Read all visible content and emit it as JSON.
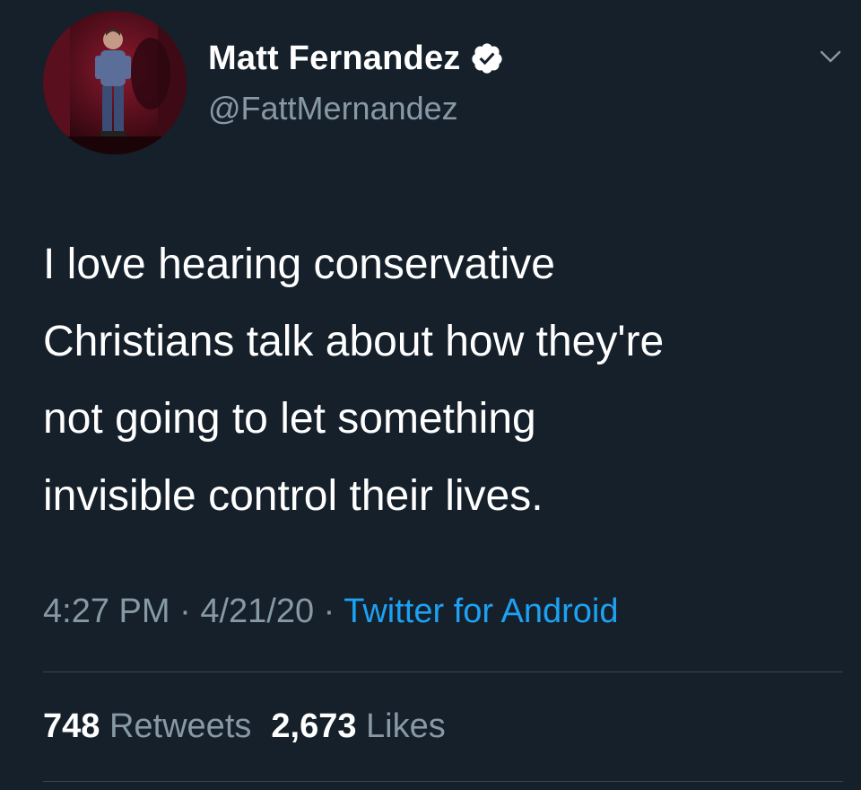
{
  "author": {
    "display_name": "Matt Fernandez",
    "handle": "@FattMernandez",
    "verified": true,
    "avatar_icon": "avatar-comedian-on-stage"
  },
  "tweet": {
    "text": "I love hearing conservative\nChristians talk about how they're\nnot going to let something\ninvisible control their lives.",
    "time": "4:27 PM",
    "separator1": " · ",
    "date": "4/21/20",
    "separator2": " · ",
    "source": "Twitter for Android"
  },
  "stats": {
    "retweets_count": "748",
    "retweets_label": "Retweets",
    "likes_count": "2,673",
    "likes_label": "Likes"
  },
  "colors": {
    "background": "#15202b",
    "primary_text": "#ffffff",
    "secondary_text": "#8899a6",
    "link": "#1da1f2",
    "divider": "#38444d"
  }
}
